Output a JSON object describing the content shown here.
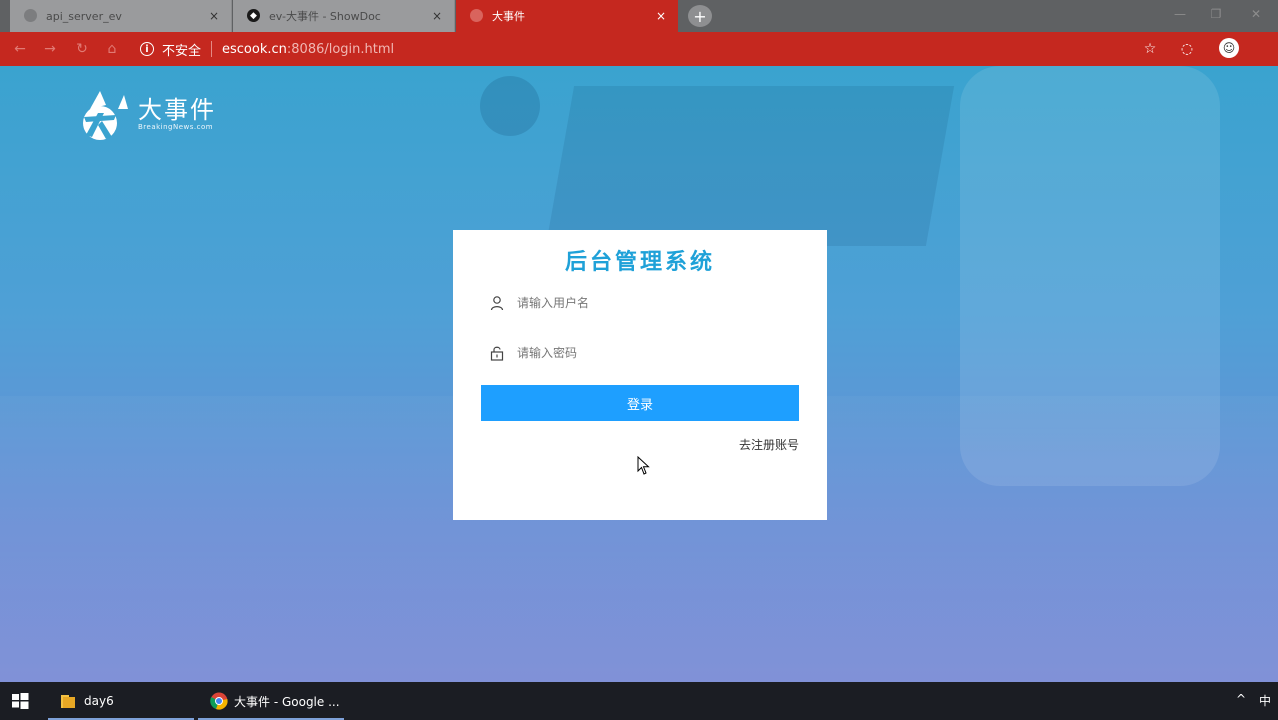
{
  "browser": {
    "tabs": [
      {
        "label": "api_server_ev",
        "active": false
      },
      {
        "label": "ev-大事件 - ShowDoc",
        "active": false
      },
      {
        "label": "大事件",
        "active": true
      }
    ],
    "new_tab_label": "+",
    "tab_close_label": "×",
    "security_label": "不安全",
    "url_host": "escook.cn",
    "url_rest": ":8086/login.html",
    "accent_color": "#c5281f"
  },
  "logo": {
    "name": "大事件",
    "subtitle": "BreakingNews.com"
  },
  "login": {
    "title": "后台管理系统",
    "username_placeholder": "请输入用户名",
    "password_placeholder": "请输入密码",
    "submit_label": "登录",
    "register_link": "去注册账号",
    "button_color": "#1e9fff"
  },
  "taskbar": {
    "items": [
      {
        "label": "day6",
        "icon": "folder-icon"
      },
      {
        "label": "大事件 - Google ...",
        "icon": "chrome-icon"
      }
    ],
    "tray_ime": "中",
    "tray_chevron": "^"
  }
}
